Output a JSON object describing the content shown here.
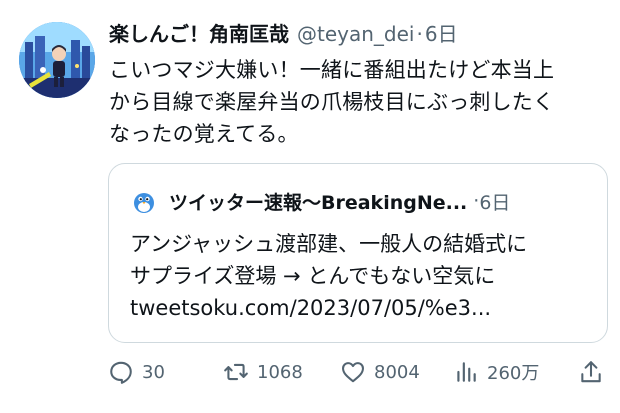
{
  "tweet": {
    "display_name": "楽しんご！角南匡哉",
    "handle": "@teyan_dei",
    "separator": "·",
    "time": "6日",
    "text": "こいつマジ大嫌い！一緒に番組出たけど本当上\nから目線で楽屋弁当の爪楊枝目にぶっ刺したく\nなったの覚えてる。"
  },
  "quote": {
    "name": "ツイッター速報〜BreakingNe...",
    "separator": "·",
    "time": "6日",
    "text": "アンジャッシュ渡部建、一般人の結婚式に\nサプライズ登場 → とんでもない空気に\ntweetsoku.com/2023/07/05/%e3..."
  },
  "actions": {
    "replies": "30",
    "retweets": "1068",
    "likes": "8004",
    "views": "260万"
  },
  "colors": {
    "text": "#0f1419",
    "secondary": "#536471",
    "border": "#cfd9de"
  }
}
